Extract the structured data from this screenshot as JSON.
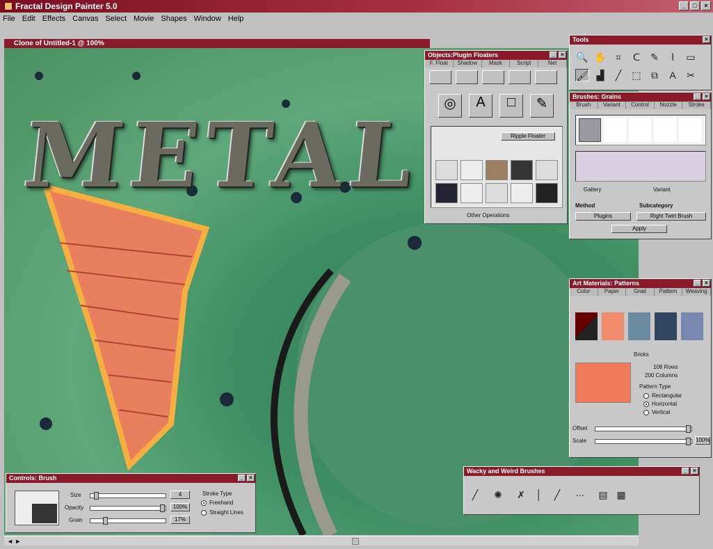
{
  "app": {
    "title": "Fractal Design Painter 5.0",
    "window_buttons": [
      "_",
      "□",
      "×"
    ]
  },
  "menu": [
    "File",
    "Edit",
    "Effects",
    "Canvas",
    "Select",
    "Movie",
    "Shapes",
    "Window",
    "Help"
  ],
  "document": {
    "title": "Clone of Untitled-1 @ 100%",
    "canvas_text": "METAL",
    "status": "◄ ►"
  },
  "art_materials": {
    "title": "Objects:Plugin Floaters",
    "tabs": [
      "F. Float",
      "Shadow",
      "Mask",
      "Script",
      "Net"
    ],
    "tooltip": "Ripple Floater",
    "footer": "Other Operations",
    "colors": {
      "accent": "#8a1a2a"
    }
  },
  "tools": {
    "title": "Tools",
    "icons": [
      "magnifier-icon",
      "grabber-icon",
      "crop-icon",
      "lasso-icon",
      "pen-icon",
      "shape-icon",
      "rect-icon",
      "brush-icon",
      "bucket-icon",
      "dropper-icon",
      "selection-icon",
      "floater-icon",
      "text-icon",
      "scissors-icon"
    ]
  },
  "brushes": {
    "title": "Brushes: Grains",
    "tabs": [
      "Brush",
      "Variant",
      "Control",
      "Nozzle",
      "Stroke"
    ],
    "variant_label": "Variant",
    "method_label": "Method",
    "subcategory_label": "Subcategory",
    "method_value": "Plugins",
    "subcategory_value": "Right Twirl Brush",
    "category": "Gallery",
    "apply": "Apply"
  },
  "patterns": {
    "title": "Art Materials: Patterns",
    "tabs": [
      "Color",
      "Paper",
      "Grad",
      "Pattern",
      "Weaving"
    ],
    "section": "Bricks",
    "rows_label": "108 Rows",
    "cols_label": "200 Columns",
    "type_label": "Pattern Type",
    "options": [
      "Rectangular",
      "Horizontal",
      "Vertical"
    ],
    "selected_option": 1,
    "offset_label": "Offset",
    "scale_label": "Scale",
    "scale_value": "100%",
    "colors": {
      "brick": "#e87a5a",
      "mortar": "#f0c8a0"
    }
  },
  "brush_controls": {
    "title": "Controls: Brush",
    "size_label": "Size",
    "opacity_label": "Opacity",
    "grain_label": "Grain",
    "size_value": "4",
    "opacity_value": "100%",
    "grain_value": "17%",
    "stroke_type_label": "Stroke Type",
    "stroke_options": [
      "Freehand",
      "Straight Lines"
    ],
    "selected_stroke": 0
  },
  "shortcut_bar": {
    "title": "Wacky and Weird Brushes"
  }
}
